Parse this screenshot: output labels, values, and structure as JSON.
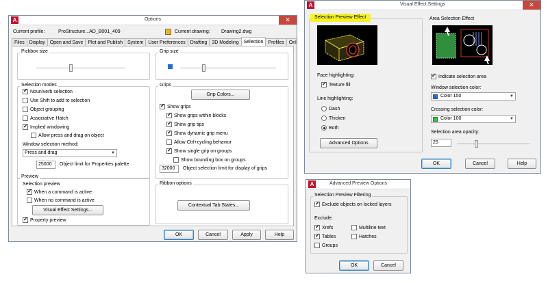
{
  "options": {
    "title": "Options",
    "current_profile_label": "Current profile:",
    "current_profile_value": "ProStructure...AD_B001_409",
    "current_drawing_label": "Current drawing:",
    "current_drawing_value": "Drawing2.dwg",
    "tabs": [
      "Files",
      "Display",
      "Open and Save",
      "Plot and Publish",
      "System",
      "User Preferences",
      "Drafting",
      "3D Modeling",
      "Selection",
      "Profiles",
      "Online"
    ],
    "pickbox_label": "Pickbox size",
    "grip_size_label": "Grip size",
    "selection_modes_label": "Selection modes",
    "modes": {
      "noun_verb": "Noun/verb selection",
      "use_shift": "Use Shift to add to selection",
      "object_grouping": "Object grouping",
      "assoc_hatch": "Associative Hatch",
      "implied_windowing": "Implied windowing",
      "allow_press_drag": "Allow press and drag on object"
    },
    "window_method_label": "Window selection method:",
    "window_method_value": "Press and drag",
    "object_limit_value": "25000",
    "object_limit_label": "Object limit for Properties palette",
    "preview_label": "Preview",
    "selection_preview_label": "Selection preview",
    "when_active": "When a command is active",
    "when_no_command": "When no command is active",
    "visual_effect_button": "Visual Effect Settings...",
    "property_preview": "Property preview",
    "grips_label": "Grips",
    "grip_colors_button": "Grip Colors...",
    "show_grips": "Show grips",
    "grips_within_blocks": "Show grips within blocks",
    "grip_tips": "Show grip tips",
    "dynamic_grip_menu": "Show dynamic grip menu",
    "ctrl_cycling": "Allow Ctrl+cycling behavior",
    "single_grip_groups": "Show single grip on groups",
    "bbox_groups": "Show bounding box on groups",
    "grip_limit_value": "32000",
    "grip_limit_label": "Object selection limit for display of grips",
    "ribbon_label": "Ribbon options",
    "contextual_button": "Contextual Tab States...",
    "ok": "OK",
    "cancel": "Cancel",
    "apply": "Apply",
    "help": "Help"
  },
  "visual_effect": {
    "title": "Visual Effect Settings",
    "selection_preview_effect": "Selection Preview Effect",
    "area_selection_effect": "Area Selection Effect",
    "face_highlighting": "Face highlighting:",
    "texture_fill": "Texture fill",
    "line_highlighting": "Line highlighting:",
    "dash": "Dash",
    "thicken": "Thicken",
    "both": "Both",
    "advanced_button": "Advanced Options",
    "indicate_area": "Indicate selection area",
    "window_color_label": "Window selection color:",
    "window_color_value": "Color 150",
    "crossing_color_label": "Crossing selection color:",
    "crossing_color_value": "Color 100",
    "opacity_label": "Selection area opacity:",
    "opacity_value": "25",
    "ok": "OK",
    "cancel": "Cancel",
    "help": "Help"
  },
  "advanced_preview": {
    "title": "Advanced Preview Options",
    "filtering_label": "Selection Preview Filtering",
    "exclude_locked": "Exclude objects on locked layers",
    "exclude_label": "Exclude:",
    "xrefs": "Xrefs",
    "tables": "Tables",
    "groups": "Groups",
    "multiline_text": "Multiline text",
    "hatches": "Hatches",
    "ok": "OK",
    "cancel": "Cancel"
  },
  "colors": {
    "window_swatch": "#1f6fd1",
    "crossing_swatch": "#2ecc40",
    "grip_blue": "#1e6fd9",
    "highlight": "#f7f32a",
    "close_red": "#c9463d"
  }
}
